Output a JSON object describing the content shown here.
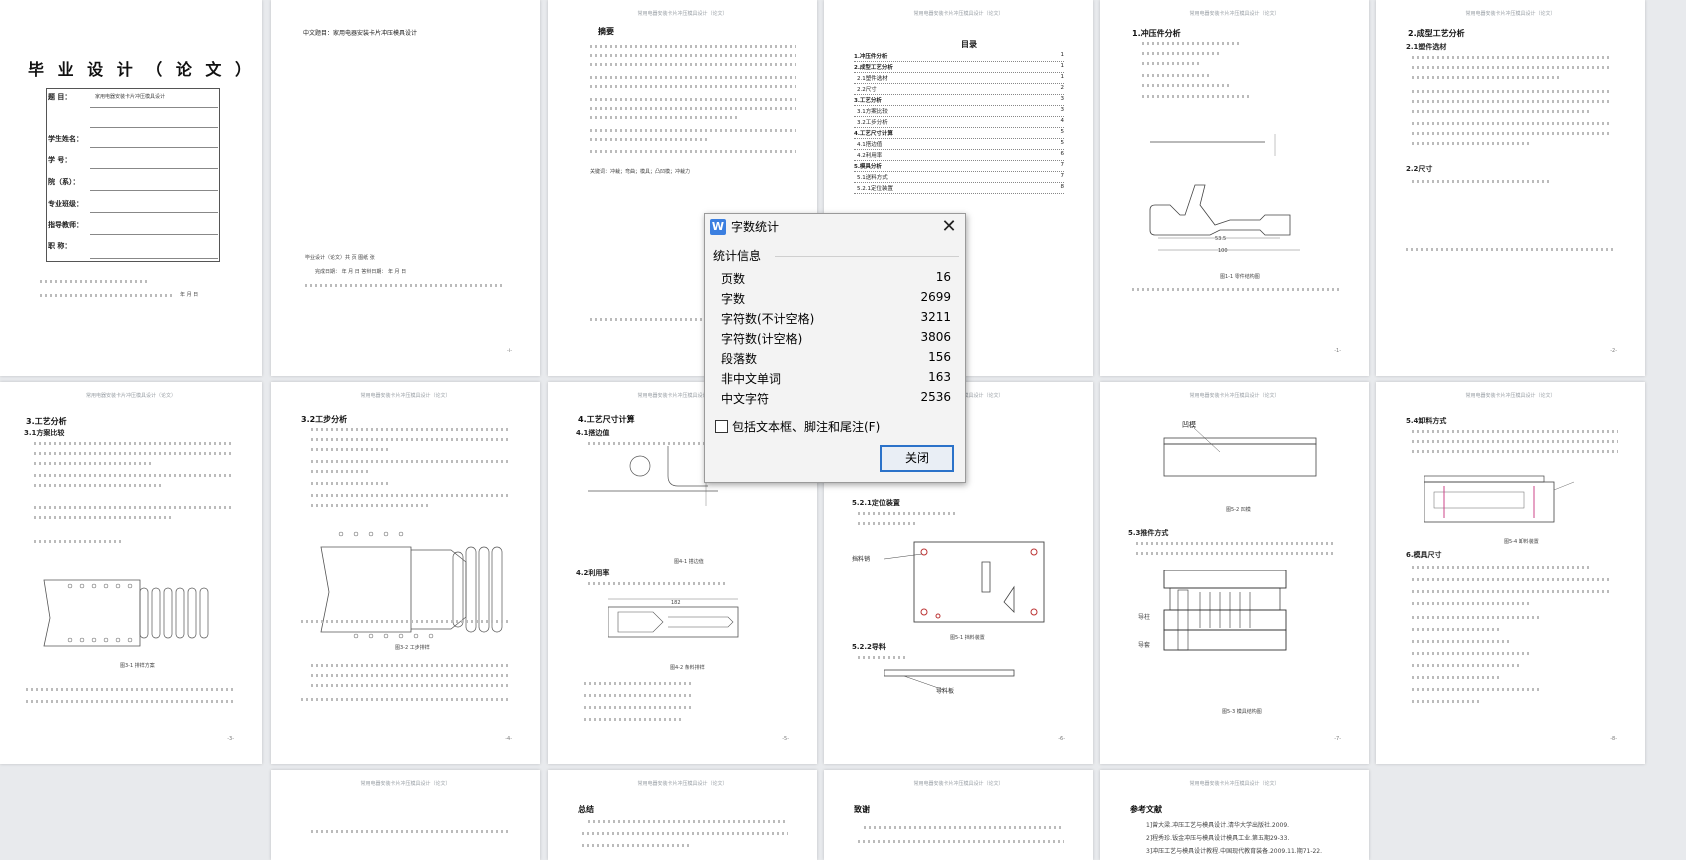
{
  "dialog": {
    "title": "字数统计",
    "group_label": "统计信息",
    "stats": [
      {
        "label": "页数",
        "value": "16"
      },
      {
        "label": "字数",
        "value": "2699"
      },
      {
        "label": "字符数(不计空格)",
        "value": "3211"
      },
      {
        "label": "字符数(计空格)",
        "value": "3806"
      },
      {
        "label": "段落数",
        "value": "156"
      },
      {
        "label": "非中文单词",
        "value": "163"
      },
      {
        "label": "中文字符",
        "value": "2536"
      }
    ],
    "checkbox_label": "包括文本框、脚注和尾注(F)",
    "checkbox_checked": false,
    "close_button": "关闭",
    "app_icon_letter": "W"
  },
  "doc": {
    "header": "常用电器安装卡片冲压模具设计（论文）",
    "p1": {
      "title": "毕 业 设 计 （ 论 文 ）",
      "topic_label": "题 目：",
      "topic_value": "家用电器安装卡片冲压模具设计",
      "fields": [
        "学生姓名：",
        "学 号：",
        "院（系）：",
        "专业班级：",
        "指导教师：",
        "职 称："
      ],
      "date": "年 月 日"
    },
    "p2": {
      "topic": "中文题目：家用电器安装卡片冲压模具设计",
      "stat_line": "毕业设计（论文）共 页    图纸 张",
      "date_line": "完成日期： 年 月 日   答辩日期： 年 月 日"
    },
    "p3": {
      "title": "摘要",
      "keywords": "关键词：冲裁；弯曲；模具；凸凹模；冲裁力"
    },
    "p4": {
      "title": "目录",
      "items": [
        {
          "text": "1.冲压件分析",
          "page": "1"
        },
        {
          "text": "2.成型工艺分析",
          "page": "1"
        },
        {
          "text": "2.1塑件选材",
          "page": "1"
        },
        {
          "text": "2.2尺寸",
          "page": "2"
        },
        {
          "text": "3.工艺分析",
          "page": "3"
        },
        {
          "text": "3.1方案比较",
          "page": "3"
        },
        {
          "text": "3.2工步分析",
          "page": "4"
        },
        {
          "text": "4.工艺尺寸计算",
          "page": "5"
        },
        {
          "text": "4.1搭边值",
          "page": "5"
        },
        {
          "text": "4.2利用率",
          "page": "6"
        },
        {
          "text": "5.模具分析",
          "page": "7"
        },
        {
          "text": "5.1送料方式",
          "page": "7"
        },
        {
          "text": "5.2.1定位装置",
          "page": "8"
        }
      ]
    },
    "p5": {
      "title": "1.冲压件分析",
      "fig": "图1-1 零件结构图",
      "dim1": "53.5",
      "dim2": "100"
    },
    "p6": {
      "title": "2.成型工艺分析",
      "sub1": "2.1塑件选材",
      "sub2": "2.2尺寸"
    },
    "p7": {
      "title": "3.工艺分析",
      "sub1": "3.1方案比较",
      "fig": "图3-1 排样方案"
    },
    "p8": {
      "title": "3.2工步分析",
      "fig": "图3-2 工步排样"
    },
    "p9": {
      "title": "4.工艺尺寸计算",
      "sub1": "4.1搭边值",
      "sub2": "4.2利用率",
      "fig1": "图4-1 搭边值",
      "fig2": "图4-2 条料排样",
      "dim": "182"
    },
    "p10": {
      "sub1": "5.2.1定位装置",
      "sub2": "5.2.2导料",
      "label1": "挡料销",
      "label2": "导料板",
      "fig": "图5-1 挡料装置"
    },
    "p11": {
      "label1": "凹模",
      "sub1": "5.3推件方式",
      "label2": "导柱",
      "label3": "导套",
      "fig1": "图5-2 凹模",
      "fig2": "图5-3 模具结构图"
    },
    "p12": {
      "title": "5.4卸料方式",
      "title2": "6.模具尺寸",
      "fig": "图5-4 卸料装置"
    },
    "p14": {
      "title": "总结"
    },
    "p15": {
      "title": "致谢"
    },
    "p16": {
      "title": "参考文献",
      "refs": [
        "1]曾大梁.冲压工艺与模具设计.清华大学出版社.2009.",
        "2]程秀珍.钣金冲压与模具设计模具工业.第五期29-33.",
        "3]冲压工艺与模具设计教程.中国现代教育装备.2009.11.期71-22."
      ]
    }
  }
}
